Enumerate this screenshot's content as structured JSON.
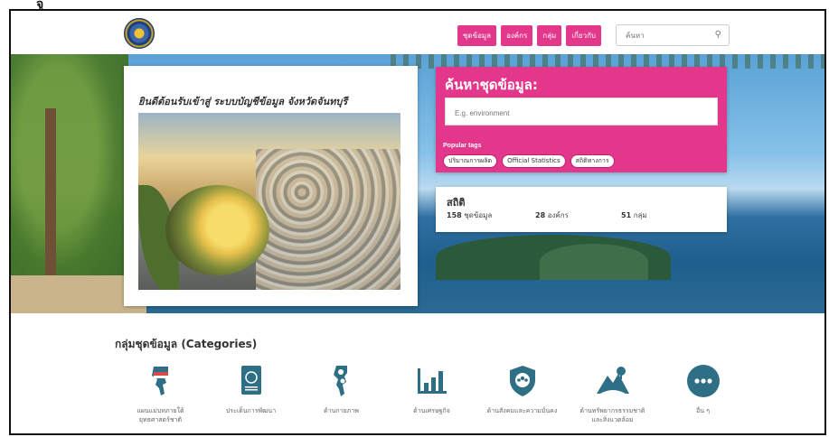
{
  "corner_glyph": "จู",
  "header": {
    "nav": [
      "ชุดข้อมูล",
      "องค์กร",
      "กลุ่ม",
      "เกี่ยวกับ"
    ],
    "search_placeholder": "ค้นหา"
  },
  "hero": {
    "welcome_title": "ยินดีต้อนรับเข้าสู่ ระบบบัญชีข้อมูล จังหวัดจันทบุรี",
    "search_title": "ค้นหาชุดข้อมูล:",
    "search_placeholder": "E.g. environment",
    "popular_tags_label": "Popular tags",
    "tags": [
      "ปริมาณการผลิต",
      "Official Statistics",
      "สถิติทางการ"
    ],
    "stats_title": "สถิติ",
    "stats": [
      {
        "num": "158",
        "label": "ชุดข้อมูล"
      },
      {
        "num": "28",
        "label": "องค์กร"
      },
      {
        "num": "51",
        "label": "กลุ่ม"
      }
    ]
  },
  "categories": {
    "heading": "กลุ่มชุดข้อมูล (Categories)",
    "items": [
      {
        "line1": "แผนแม่บทภายใต้",
        "line2": "ยุทธศาสตร์ชาติ"
      },
      {
        "line1": "ประเด็นการพัฒนา",
        "line2": ""
      },
      {
        "line1": "ด้านกายภาพ",
        "line2": ""
      },
      {
        "line1": "ด้านเศรษฐกิจ",
        "line2": ""
      },
      {
        "line1": "ด้านสังคมและความมั่นคง",
        "line2": ""
      },
      {
        "line1": "ด้านทรัพยากรธรรมชาติ",
        "line2": "และสิ่งแวดล้อม"
      },
      {
        "line1": "อื่น ๆ",
        "line2": ""
      }
    ]
  },
  "colors": {
    "brand_pink": "#e2378a",
    "icon_teal": "#2e6f86"
  }
}
